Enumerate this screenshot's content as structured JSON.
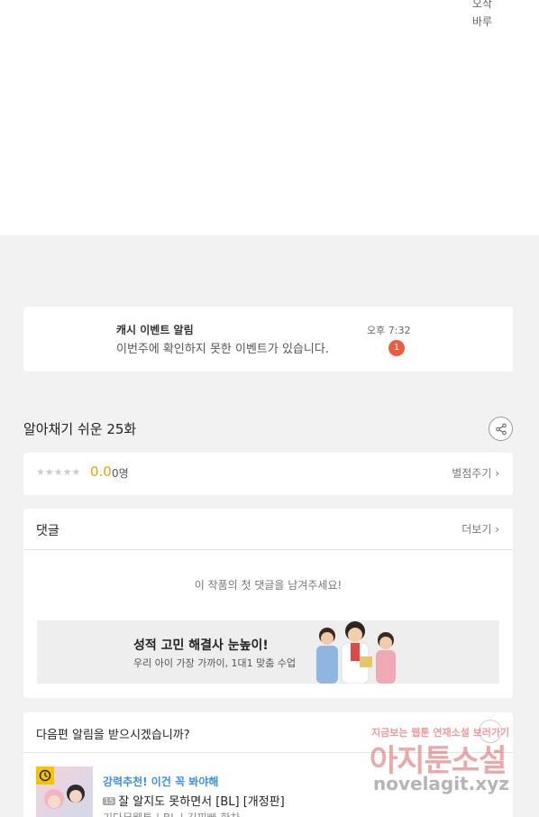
{
  "top": {
    "line1": "오삭",
    "line2": "바루"
  },
  "notification": {
    "title": "캐시 이벤트 알림",
    "message": "이번주에 확인하지 못한 이벤트가 있습니다.",
    "time": "오후 7:32",
    "badge": "1"
  },
  "episode": {
    "title": "알아채기 쉬운 25화"
  },
  "rating": {
    "stars": "★★★★★",
    "score": "0.0",
    "count": "0명",
    "rate_link": "별점주기 ›"
  },
  "comments": {
    "title": "댓글",
    "more": "더보기 ›",
    "empty": "이 작품의 첫 댓글을 남겨주세요!",
    "ad": {
      "title": "성적 고민 해결사 눈높이!",
      "subtitle": "우리 아이 가장 가까이, 1대1 맞춤 수업"
    }
  },
  "next": {
    "question": "다음편 알림을 받으시겠습니까?",
    "rec_label": "강력추천! 이건 꼭 봐야해",
    "age": "15",
    "rec_title": "잘 알지도 못하면서 [BL] [개정판]",
    "rec_meta": "기다무웹툰 | BL | 김찌빠 한차"
  },
  "watermark": {
    "line1": "지금보는 웹툰 연재소설 보러가기",
    "line2": "아지툰소설",
    "line3": "novelagit.xyz"
  },
  "colors": {
    "accent_score": "#e6a400",
    "badge": "#f05a3c",
    "link_blue": "#3b8ee8"
  }
}
